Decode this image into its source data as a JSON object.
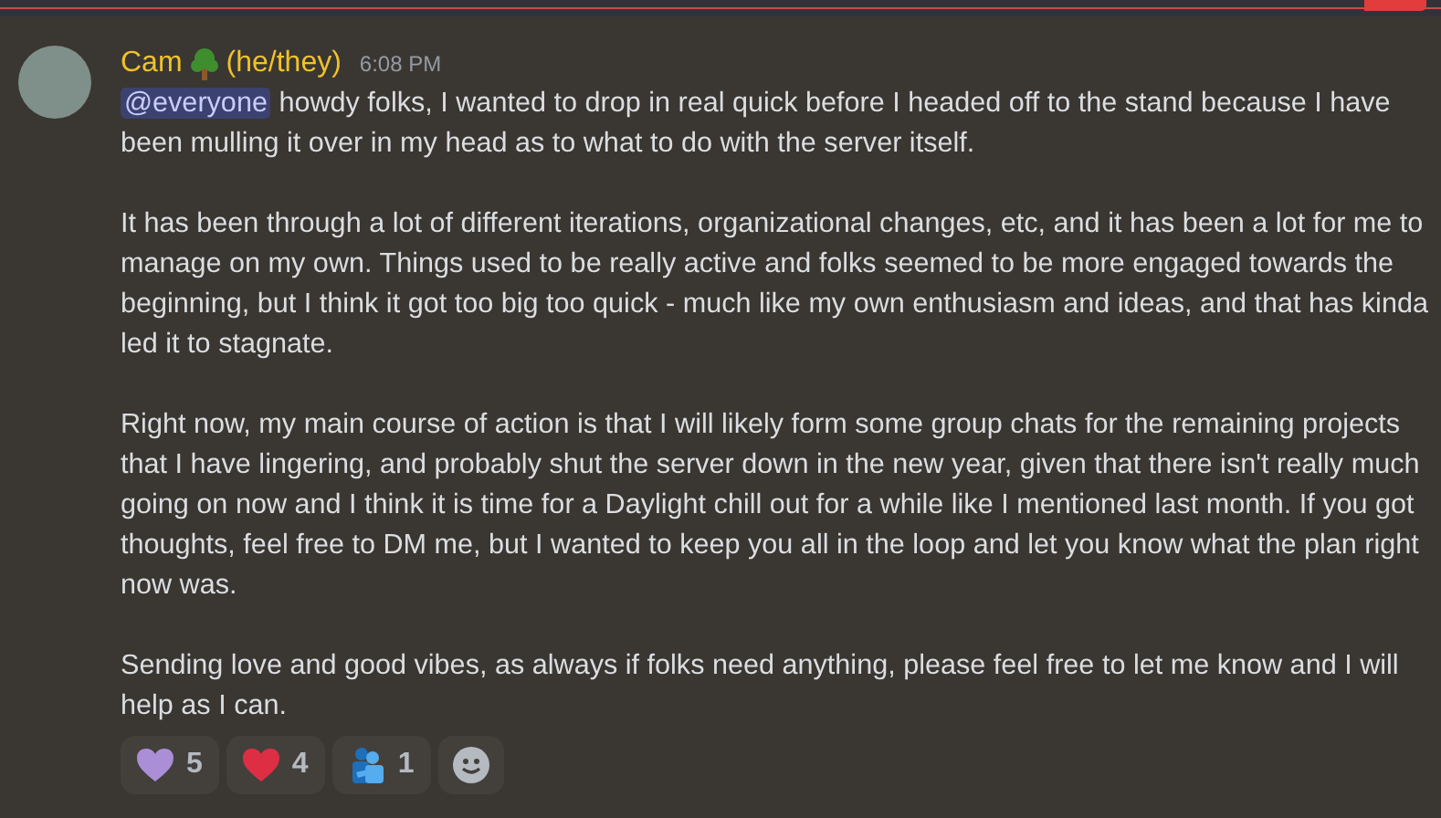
{
  "message": {
    "author": "Cam",
    "pronouns": "(he/they)",
    "timestamp": "6:08 PM",
    "mention": "@everyone",
    "paragraphs": [
      "howdy folks, I wanted to drop in real quick before I headed off to the stand because I have been mulling it over in my head as to what to do with the server itself.",
      "It has been through a lot of different iterations, organizational changes, etc, and it has been a lot for me to manage on my own. Things used to be really active and folks seemed to be more engaged towards the beginning, but I think it got too big too quick - much like my own enthusiasm and ideas, and that has kinda led it to stagnate.",
      "Right now, my main course of action is that I will likely form some group chats for the remaining projects that I have lingering, and probably shut the server down in the new year, given that there isn't really much going on now and I think it is time for a Daylight chill out for a while like I mentioned last month. If you got thoughts, feel free to DM me, but I wanted to keep you all in the loop and let you know what the plan right now was.",
      "Sending love and good vibes, as always if folks need anything, please feel free to let me know and I will help as I can."
    ]
  },
  "reactions": [
    {
      "kind": "purple-heart",
      "count": "5"
    },
    {
      "kind": "red-heart",
      "count": "4"
    },
    {
      "kind": "hug",
      "count": "1"
    }
  ]
}
